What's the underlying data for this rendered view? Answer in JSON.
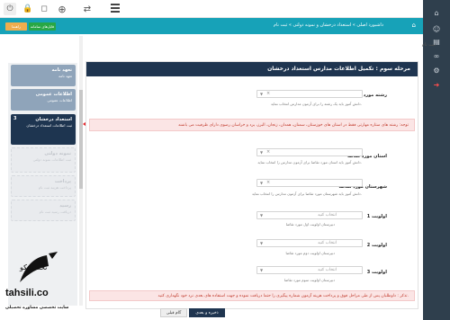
{
  "topbar": {
    "icons": [
      "logout-icon",
      "lock-icon",
      "notification-icon",
      "globe-icon",
      "sync-icon",
      "menu-icon"
    ]
  },
  "sidebar_right": {
    "icons": [
      "home-icon",
      "user-icon",
      "document-icon",
      "link-icon",
      "settings-icon",
      "logout-icon"
    ],
    "active_color": "#ff4d4d",
    "bg_color": "#2f3f4d"
  },
  "breadcrumb": {
    "text": "داشبورد اصلی » استعداد درخشان و نمونه دولتی » ثبت نام",
    "guide_button": "راهنما",
    "forms_button": "فایل‌های سامانه",
    "bar_color": "#17a2b8"
  },
  "section_title": "ثبت نام",
  "steps": [
    {
      "title": "تعهد نامه",
      "subtitle": "تعهد نامه",
      "state": "done"
    },
    {
      "title": "اطلاعات عمومی",
      "subtitle": "اطلاعات عمومی",
      "state": "done"
    },
    {
      "num": "3",
      "title": "استعداد درخشان",
      "subtitle": "ثبت اطلاعات استعداد درخشان",
      "state": "active"
    },
    {
      "title": "نمونه دولتی",
      "subtitle": "ثبت اطلاعات نمونه دولتی",
      "state": "pending"
    },
    {
      "title": "پرداخت",
      "subtitle": "پرداخت هزینه ثبت نام",
      "state": "pending"
    },
    {
      "title": "رسید",
      "subtitle": "دریافت رسید ثبت نام",
      "state": "pending"
    }
  ],
  "panel": {
    "header": "مرحله سوم : تکمیل اطلاعات مدارس استعداد درخشان",
    "notice": "توجه: رشته های ستاره مهارتی فقط در استان های خوزستان، سمنان، همدان، زنجان، البرز، یزد و خراسان رضوی دارای ظرفیت می باشند",
    "fields": [
      {
        "label": "رشته مورد تقاضا",
        "value": "",
        "help": "دانش آموز باید یک رشته را برای آزمون مدارس انتخاب نماید."
      },
      {
        "label": "استان مورد تقاضا",
        "value": "",
        "help": "دانش آموز باید استان مورد تقاضا برای آزمون مدارس را انتخاب نماید."
      },
      {
        "label": "شهرستان مورد تقاضا",
        "value": "",
        "help": "دانش آموز باید شهرستان مورد تقاضا برای آزمون مدارس را انتخاب نماید."
      },
      {
        "label": "اولویت 1",
        "placeholder": "انتخاب کنید",
        "help": "دبیرستان اولویت اول مورد تقاضا"
      },
      {
        "label": "اولویت 2",
        "placeholder": "انتخاب کنید",
        "help": "دبیرستان اولویت دوم مورد تقاضا"
      },
      {
        "label": "اولویت 3",
        "placeholder": "انتخاب کنید",
        "help": "دبیرستان اولویت سوم مورد تقاضا"
      }
    ],
    "warning": "تذکر : داوطلبان پس از طی مراحل فوق و پرداخت هزینه آزمون شماره پیگیری را حتما دریافت نموده و جهت استفاده های بعدی نزد خود نگهداری کنید.",
    "prev_button": "گام قبلی",
    "next_button": "ذخیره و بعدی"
  },
  "watermark": {
    "brand": "تحصیلیکو",
    "site": "tahsili.co",
    "tagline": "سایت تخصصی مشاوره تحصیلی"
  },
  "colors": {
    "header_navy": "#1f3550",
    "arrow_red": "#e4262b",
    "notice_bg": "#fbe5e5"
  }
}
